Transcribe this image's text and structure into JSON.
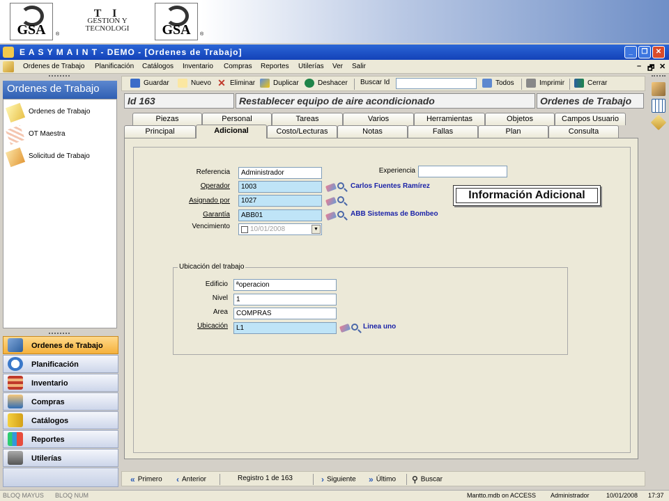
{
  "banner": {
    "logo1": "GSA",
    "logo_mark": "®",
    "ti_line1": "T I",
    "ti_line2": "GESTION Y",
    "ti_line3": "TECNOLOGI",
    "logo2": "GSA"
  },
  "window": {
    "title": "E A S Y    M A I N T  -  DEMO - [Ordenes de Trabajo]",
    "minimize": "_",
    "restore": "❐",
    "close": "✕"
  },
  "menubar": {
    "items": [
      "Ordenes de Trabajo",
      "Planificación",
      "Catálogos",
      "Inventario",
      "Compras",
      "Reportes",
      "Utilerías",
      "Ver",
      "Salir"
    ],
    "controls": [
      "–",
      "🗗",
      "✕"
    ]
  },
  "leftpanel": {
    "title": "Ordenes de Trabajo",
    "list": [
      {
        "label": "Ordenes de Trabajo",
        "icon": "work-order-icon"
      },
      {
        "label": "OT Maestra",
        "icon": "master-order-icon"
      },
      {
        "label": "Solicitud de Trabajo",
        "icon": "request-icon"
      }
    ],
    "nav": [
      {
        "label": "Ordenes de Trabajo",
        "icon": "book-icon",
        "selected": true
      },
      {
        "label": "Planificación",
        "icon": "clock-icon"
      },
      {
        "label": "Inventario",
        "icon": "shelf-icon"
      },
      {
        "label": "Compras",
        "icon": "shopper-icon"
      },
      {
        "label": "Catálogos",
        "icon": "catalog-icon"
      },
      {
        "label": "Reportes",
        "icon": "report-chart-icon"
      },
      {
        "label": "Utilerías",
        "icon": "utilities-icon"
      }
    ]
  },
  "toolbar": {
    "guardar": "Guardar",
    "nuevo": "Nuevo",
    "eliminar": "Eliminar",
    "duplicar": "Duplicar",
    "deshacer": "Deshacer",
    "buscar_id": "Buscar Id",
    "buscar_value": "",
    "todos": "Todos",
    "imprimir": "Imprimir",
    "cerrar": "Cerrar"
  },
  "header": {
    "id": "Id  163",
    "description": "Restablecer equipo de aire acondicionado",
    "module": "Ordenes de Trabajo"
  },
  "tabs": {
    "row1": [
      "Piezas",
      "Personal",
      "Tareas",
      "Varios",
      "Herramientas",
      "Objetos",
      "Campos Usuario"
    ],
    "row2": [
      "Principal",
      "Adicional",
      "Costo/Lecturas",
      "Notas",
      "Fallas",
      "Plan",
      "Consulta"
    ],
    "active": "Adicional"
  },
  "form": {
    "referencia_label": "Referencia",
    "referencia_value": "Administrador",
    "experiencia_label": "Experiencia",
    "experiencia_value": "",
    "operador_label": "Operador",
    "operador_value": "1003",
    "operador_name": "Carlos Fuentes Ramírez",
    "asignado_label": "Asignado por",
    "asignado_value": "1027",
    "garantia_label": "Garantía",
    "garantia_value": "ABB01",
    "garantia_name": "ABB Sistemas de Bombeo",
    "vencimiento_label": "Vencimiento",
    "vencimiento_value": "10/01/2008",
    "callout": "Información Adicional"
  },
  "ubicacion": {
    "group_title": "Ubicación del trabajo",
    "edificio_label": "Edificio",
    "edificio_value": "ªoperacion",
    "nivel_label": "Nivel",
    "nivel_value": "1",
    "area_label": "Area",
    "area_value": "COMPRAS",
    "ubicacion_label": "Ubicación",
    "ubicacion_value": "L1",
    "ubicacion_name": "Linea uno"
  },
  "bottomnav": {
    "primero": "Primero",
    "anterior": "Anterior",
    "registro": "Registro 1 de 163",
    "siguiente": "Siguiente",
    "ultimo": "Último",
    "buscar": "Buscar"
  },
  "statusbar": {
    "mayus": "BLOQ MAYUS",
    "num": "BLOQ NUM",
    "db": "Mantto.mdb on ACCESS",
    "user": "Administrador",
    "date": "10/01/2008",
    "time": "17:37"
  },
  "colors": {
    "titlebar": "#1f55c8",
    "field_blue": "#bfe4f7",
    "ref_text": "#1b23a8",
    "nav_selected": "#f5b13c"
  }
}
